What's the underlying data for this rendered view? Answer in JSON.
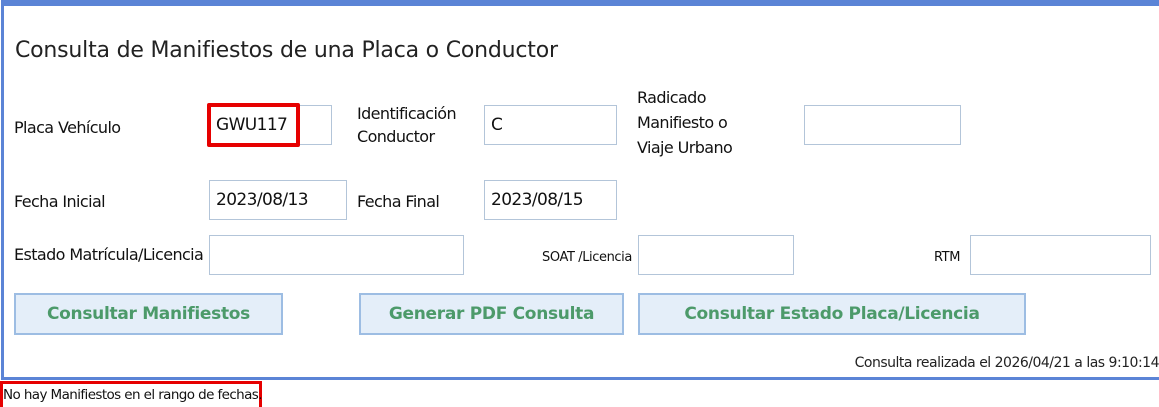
{
  "title": "Consulta de Manifiestos de una Placa o Conductor",
  "labels": {
    "placa": "Placa Vehículo",
    "identificacion_1": "Identificación",
    "identificacion_2": "Conductor",
    "radicado_1": "Radicado",
    "radicado_2": "Manifiesto o",
    "radicado_3": "Viaje Urbano",
    "fecha_inicial": "Fecha Inicial",
    "fecha_final": "Fecha Final",
    "estado": "Estado Matrícula/Licencia",
    "soat": "SOAT /Licencia",
    "rtm": "RTM"
  },
  "fields": {
    "placa": "GWU117",
    "identificacion": "C",
    "radicado": "",
    "fecha_inicial": "2023/08/13",
    "fecha_final": "2023/08/15",
    "estado": "",
    "soat": "",
    "rtm": ""
  },
  "buttons": {
    "consultar_manifiestos": "Consultar Manifiestos",
    "generar_pdf": "Generar PDF Consulta",
    "consultar_estado": "Consultar Estado Placa/Licencia"
  },
  "status": "Consulta realizada el 2026/04/21 a las 9:10:14",
  "message": "No hay Manifiestos en el rango de fechas.",
  "colors": {
    "panel_border": "#5b84d6",
    "highlight": "#e60000",
    "button_text": "#4c9a6a",
    "button_bg": "#e4eef9"
  }
}
